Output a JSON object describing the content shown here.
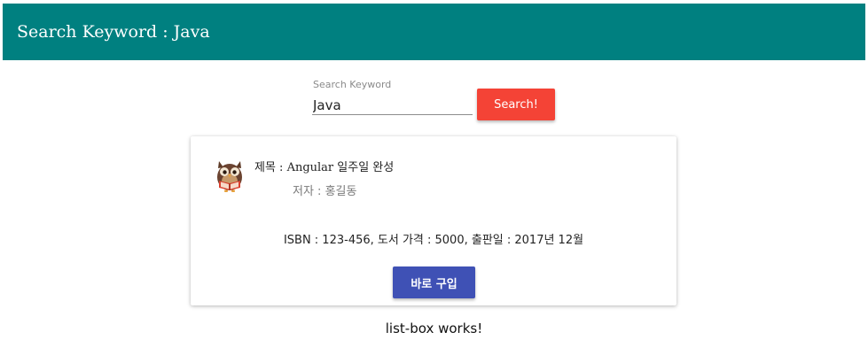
{
  "toolbar": {
    "title": "Search Keyword : Java",
    "color": "#008080"
  },
  "search": {
    "label": "Search Keyword",
    "value": "Java",
    "button_label": "Search!",
    "button_color": "#f44336"
  },
  "book": {
    "avatar_icon": "owl-reading-icon",
    "title": "제목 : Angular 일주일 완성",
    "author": "저자 : 홍길동",
    "details": "ISBN : 123-456, 도서 가격 : 5000, 출판일 : 2017년 12월",
    "buy_label": "바로 구입",
    "buy_color": "#3f51b5"
  },
  "footer": {
    "text": "list-box works!"
  }
}
